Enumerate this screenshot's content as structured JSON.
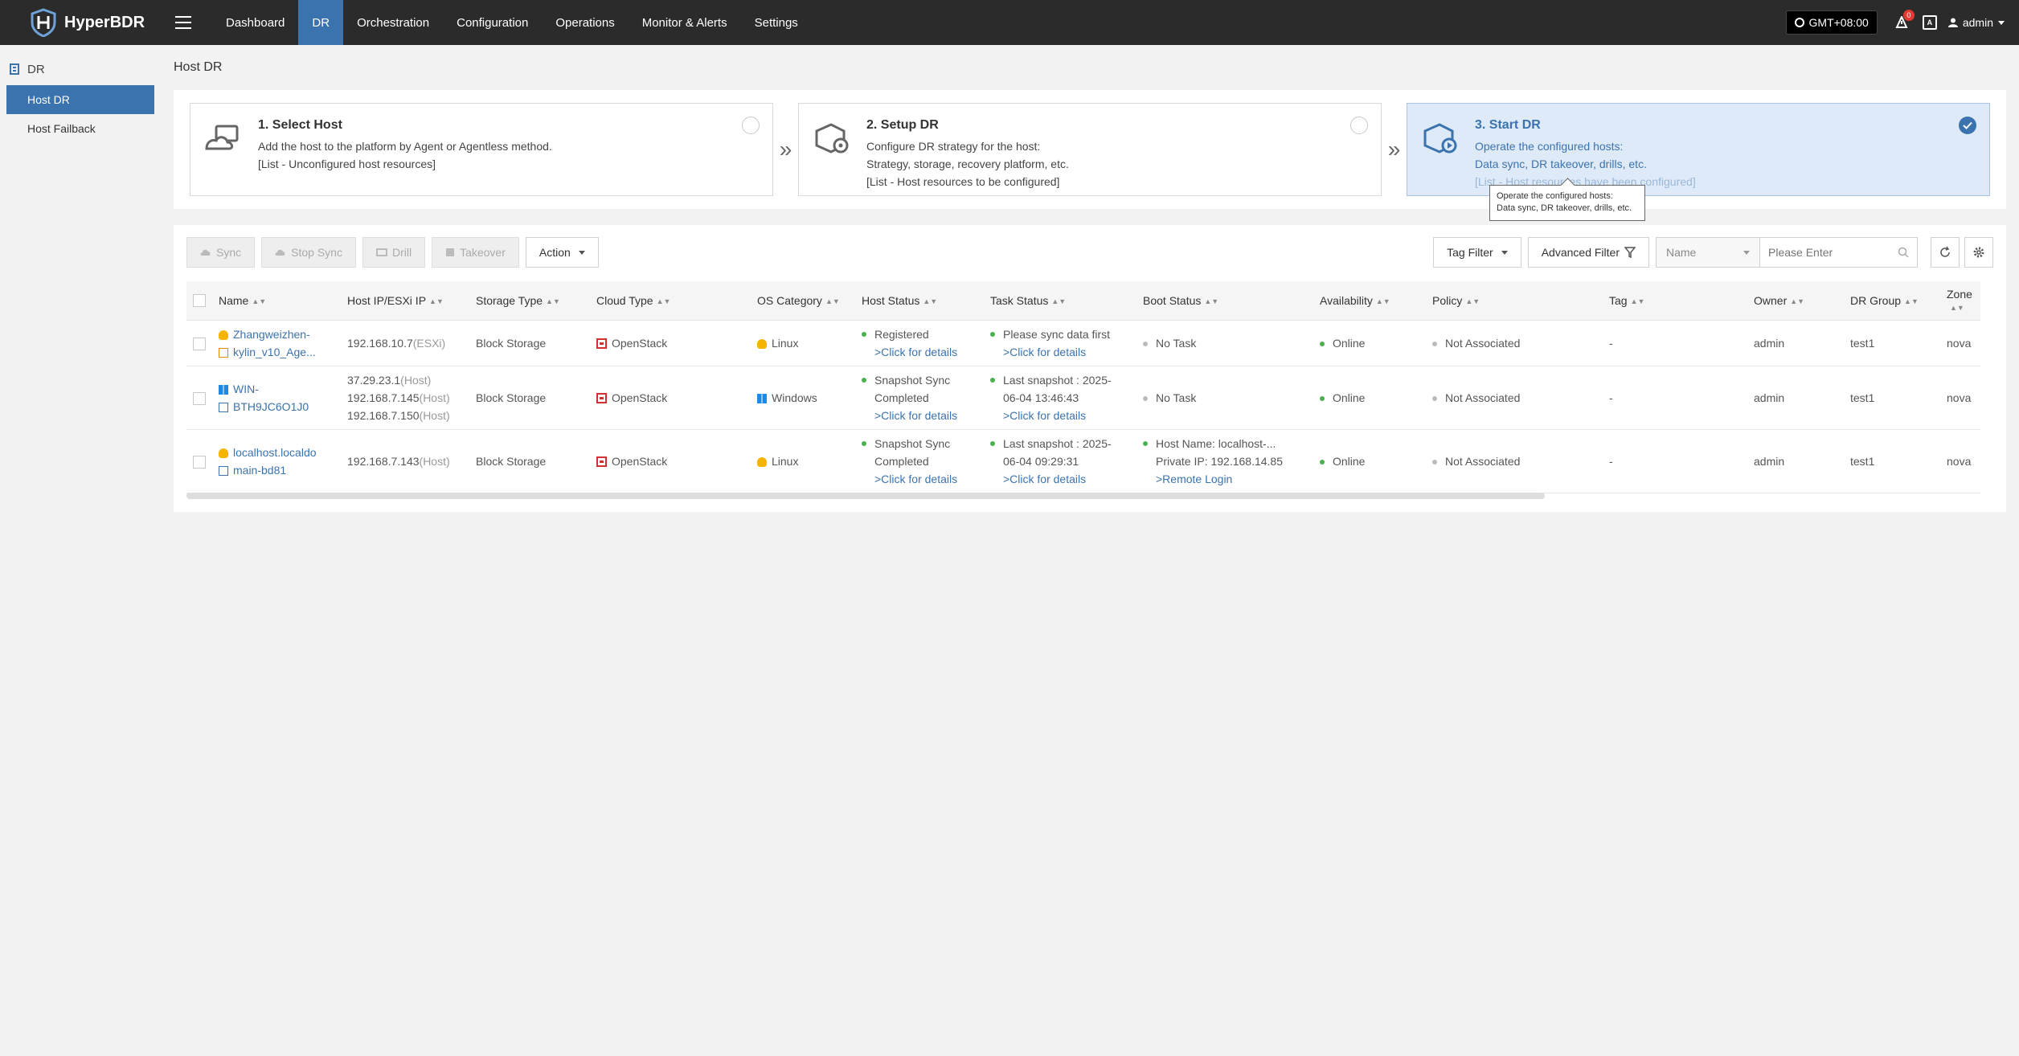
{
  "app": {
    "name": "HyperBDR",
    "brand_color": "#3b73af",
    "topbar_color": "#2b2b2b"
  },
  "nav": {
    "items": [
      "Dashboard",
      "DR",
      "Orchestration",
      "Configuration",
      "Operations",
      "Monitor & Alerts",
      "Settings"
    ],
    "active": "DR"
  },
  "topright": {
    "timezone": "GMT+08:00",
    "alerts_count": "0",
    "user": "admin"
  },
  "sidebar": {
    "section": "DR",
    "items": [
      "Host DR",
      "Host Failback"
    ],
    "active": "Host DR"
  },
  "page": {
    "title": "Host DR"
  },
  "steps": [
    {
      "title": "1. Select Host",
      "lines": [
        "Add the host to the platform by Agent or Agentless method.",
        "[List - Unconfigured host resources]"
      ],
      "checked": false
    },
    {
      "title": "2. Setup DR",
      "lines": [
        "Configure DR strategy for the host:",
        "Strategy, storage, recovery platform, etc.",
        "[List - Host resources to be configured]"
      ],
      "checked": false
    },
    {
      "title": "3. Start DR",
      "lines": [
        "Operate the configured hosts:",
        "Data sync, DR takeover, drills, etc.",
        "[List - Host resources have been configured]"
      ],
      "checked": true
    }
  ],
  "tooltip": {
    "line1": "Operate the configured hosts:",
    "line2": "Data sync, DR takeover, drills, etc."
  },
  "toolbar": {
    "sync": "Sync",
    "stop_sync": "Stop Sync",
    "drill": "Drill",
    "takeover": "Takeover",
    "action": "Action",
    "tag_filter": "Tag Filter",
    "advanced_filter": "Advanced Filter",
    "search_field": "Name",
    "search_placeholder": "Please Enter"
  },
  "table": {
    "columns": [
      "Name",
      "Host IP/ESXi IP",
      "Storage Type",
      "Cloud Type",
      "OS Category",
      "Host Status",
      "Task Status",
      "Boot Status",
      "Availability",
      "Policy",
      "Tag",
      "Owner",
      "DR Group",
      "Zone"
    ],
    "rows": [
      {
        "name_line1": "Zhangweizhen-",
        "name_line2": "kylin_v10_Age...",
        "ips": [
          {
            "ip": "192.168.10.7",
            "kind": "(ESXi)"
          }
        ],
        "storage": "Block Storage",
        "cloud": "OpenStack",
        "os": "Linux",
        "host_status": [
          "Registered"
        ],
        "host_status_link": ">Click for details",
        "task_status": [
          "Please sync data first"
        ],
        "task_status_link": ">Click for details",
        "boot_status": [
          "No Task"
        ],
        "boot_link": "",
        "availability": "Online",
        "policy": "Not Associated",
        "tag": "-",
        "owner": "admin",
        "dr_group": "test1",
        "zone": "nova"
      },
      {
        "name_line1": "WIN-",
        "name_line2": "BTH9JC6O1J0",
        "ips": [
          {
            "ip": "37.29.23.1",
            "kind": "(Host)"
          },
          {
            "ip": "192.168.7.145",
            "kind": "(Host)"
          },
          {
            "ip": "192.168.7.150",
            "kind": "(Host)"
          }
        ],
        "storage": "Block Storage",
        "cloud": "OpenStack",
        "os": "Windows",
        "host_status": [
          "Snapshot Sync",
          "Completed"
        ],
        "host_status_link": ">Click for details",
        "task_status": [
          "Last snapshot : 2025-",
          "06-04 13:46:43"
        ],
        "task_status_link": ">Click for details",
        "boot_status": [
          "No Task"
        ],
        "boot_link": "",
        "availability": "Online",
        "policy": "Not Associated",
        "tag": "-",
        "owner": "admin",
        "dr_group": "test1",
        "zone": "nova"
      },
      {
        "name_line1": "localhost.localdo",
        "name_line2": "main-bd81",
        "ips": [
          {
            "ip": "192.168.7.143",
            "kind": "(Host)"
          }
        ],
        "storage": "Block Storage",
        "cloud": "OpenStack",
        "os": "Linux",
        "host_status": [
          "Snapshot Sync",
          "Completed"
        ],
        "host_status_link": ">Click for details",
        "task_status": [
          "Last snapshot : 2025-",
          "06-04 09:29:31"
        ],
        "task_status_link": ">Click for details",
        "boot_status": [
          "Host Name: localhost-...",
          "Private IP: 192.168.14.85"
        ],
        "boot_link": ">Remote Login",
        "availability": "Online",
        "policy": "Not Associated",
        "tag": "-",
        "owner": "admin",
        "dr_group": "test1",
        "zone": "nova"
      }
    ]
  }
}
